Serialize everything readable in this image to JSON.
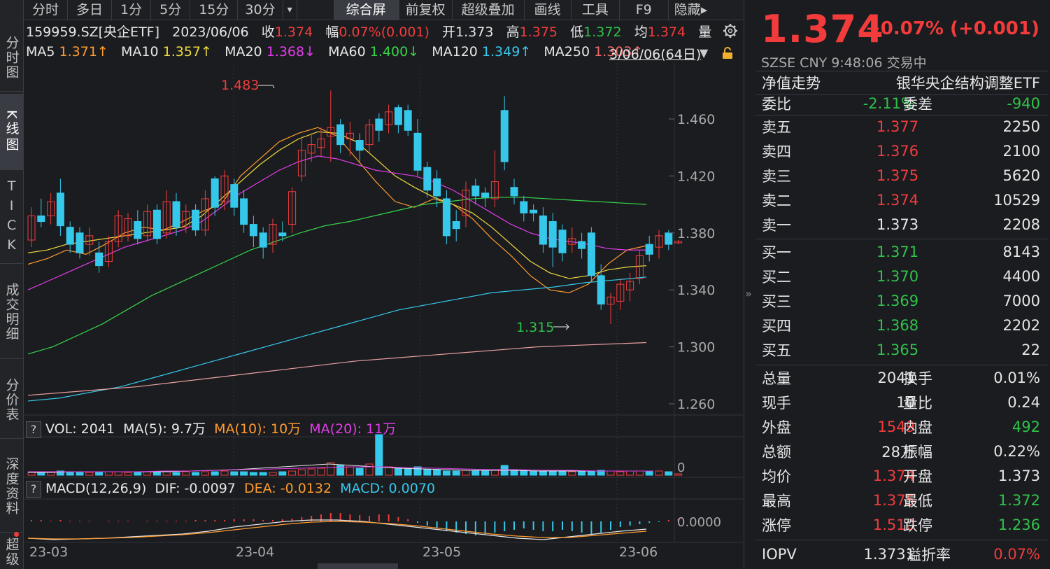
{
  "sidebar": [
    "分时图",
    "K线图",
    "TICK",
    "成交明细",
    "分价表",
    "深度资料",
    "超级"
  ],
  "toolbar": {
    "periods": [
      "分时",
      "多日",
      "1分",
      "5分",
      "15分",
      "30分"
    ],
    "dropdown_arrow": "▾",
    "right_buttons": [
      "综合屏",
      "前复权",
      "超级叠加",
      "画线",
      "工具",
      "F9",
      "隐藏▸"
    ]
  },
  "info": {
    "code": "159959.SZ[央企ETF]",
    "date": "2023/06/06",
    "close_label": "收",
    "close": "1.374",
    "range_label": "幅",
    "range": "0.07%(0.001)",
    "open_label": "开",
    "open": "1.373",
    "high_label": "高",
    "high": "1.375",
    "low_label": "低",
    "low": "1.372",
    "avg_label": "均",
    "avg": "1.374",
    "vol_label": "量"
  },
  "ma_row": {
    "items": [
      {
        "label": "MA5",
        "value": "1.371↑",
        "color": "#ff9b2f"
      },
      {
        "label": "MA10",
        "value": "1.357↑",
        "color": "#f0dc3c"
      },
      {
        "label": "MA20",
        "value": "1.368↓",
        "color": "#e23ce8"
      },
      {
        "label": "MA60",
        "value": "1.400↓",
        "color": "#36d34a"
      },
      {
        "label": "MA120",
        "value": "1.349↑",
        "color": "#36c8ea"
      },
      {
        "label": "MA250",
        "value": "1.303↑",
        "color": "#f06a6a"
      }
    ],
    "range_text": "3/06/06(64日)"
  },
  "chart_data": {
    "type": "candlestick",
    "y_ticks": [
      "1.460",
      "1.420",
      "1.380",
      "1.340",
      "1.300",
      "1.260"
    ],
    "x_ticks": [
      "23-03",
      "23-04",
      "23-05",
      "23-06"
    ],
    "annotation_high": "1.483",
    "annotation_low": "1.315",
    "colors": {
      "up": "#f23c3c",
      "down": "#36c8ea"
    }
  },
  "volume_panel": {
    "label": "VOL: 2041",
    "ma5": "MA(5): 9.7万",
    "ma10": "MA(10): 10万",
    "ma20": "MA(20): 11万",
    "axis": "0"
  },
  "macd_panel": {
    "label": "MACD(12,26,9)",
    "dif": "DIF: -0.0097",
    "dea": "DEA: -0.0132",
    "macd": "MACD: 0.0070",
    "axis": "0.0000"
  },
  "right": {
    "price": "1.374",
    "change": "+0.07% (+0.001)",
    "market": "SZSE  CNY  9:48:06  交易中",
    "nav_label": "净值走势",
    "fund_name": "银华央企结构调整ETF",
    "weibi_label": "委比",
    "weibi": "-2.11%",
    "weicha_label": "委差",
    "weicha": "-940",
    "asks": [
      {
        "label": "卖五",
        "price": "1.377",
        "vol": "2250"
      },
      {
        "label": "卖四",
        "price": "1.376",
        "vol": "2100"
      },
      {
        "label": "卖三",
        "price": "1.375",
        "vol": "5620"
      },
      {
        "label": "卖二",
        "price": "1.374",
        "vol": "10529"
      },
      {
        "label": "卖一",
        "price": "1.373",
        "vol": "2208"
      }
    ],
    "bids": [
      {
        "label": "买一",
        "price": "1.371",
        "vol": "8143"
      },
      {
        "label": "买二",
        "price": "1.370",
        "vol": "4400"
      },
      {
        "label": "买三",
        "price": "1.369",
        "vol": "7000"
      },
      {
        "label": "买四",
        "price": "1.368",
        "vol": "2202"
      },
      {
        "label": "买五",
        "price": "1.365",
        "vol": "22"
      }
    ],
    "stats": [
      {
        "l1": "总量",
        "v1": "2041",
        "l2": "换手",
        "v2": "0.01%"
      },
      {
        "l1": "现手",
        "v1": "10",
        "l2": "量比",
        "v2": "0.24"
      },
      {
        "l1": "外盘",
        "v1": "1549",
        "l2": "内盘",
        "v2": "492"
      },
      {
        "l1": "总额",
        "v1": "28万",
        "l2": "振幅",
        "v2": "0.22%"
      },
      {
        "l1": "均价",
        "v1": "1.374",
        "l2": "开盘",
        "v2": "1.373"
      },
      {
        "l1": "最高",
        "v1": "1.375",
        "l2": "最低",
        "v2": "1.372"
      },
      {
        "l1": "涨停",
        "v1": "1.510",
        "l2": "跌停",
        "v2": "1.236"
      }
    ],
    "iopv_label": "IOPV",
    "iopv": "1.3731",
    "premium_label": "溢折率",
    "premium": "0.07%"
  }
}
